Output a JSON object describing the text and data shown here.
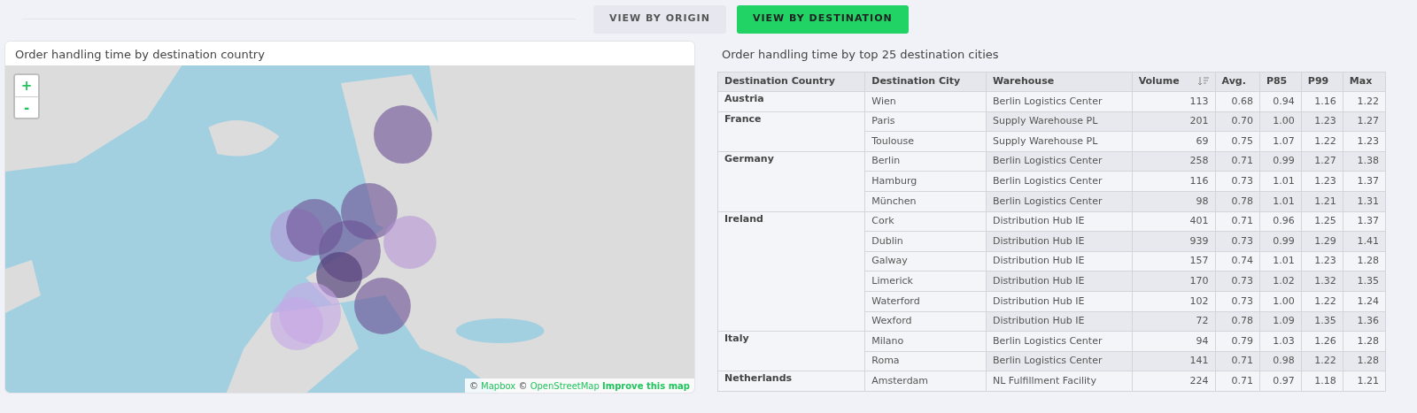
{
  "view_toggle": [
    {
      "label": "VIEW BY ORIGIN",
      "selected": false
    },
    {
      "label": "VIEW BY DESTINATION",
      "selected": true
    }
  ],
  "map_panel": {
    "title": "Order handling time by destination country",
    "zoom_in": "+",
    "zoom_out": "-",
    "attribution": [
      {
        "text": "©",
        "kind": "plain"
      },
      {
        "text": "Mapbox",
        "kind": "link"
      },
      {
        "text": "©",
        "kind": "plain"
      },
      {
        "text": "OpenStreetMap",
        "kind": "link"
      },
      {
        "text": "Improve this map",
        "kind": "strong-link"
      }
    ]
  },
  "table_panel": {
    "title": "Order handling time by top 25 destination cities",
    "columns": [
      {
        "label": "Destination Country",
        "sorted": false
      },
      {
        "label": "Destination City",
        "sorted": false
      },
      {
        "label": "Warehouse",
        "sorted": false
      },
      {
        "label": "Volume",
        "sorted": true
      },
      {
        "label": "Avg.",
        "sorted": false
      },
      {
        "label": "P85",
        "sorted": false
      },
      {
        "label": "P99",
        "sorted": false
      },
      {
        "label": "Max",
        "sorted": false
      }
    ],
    "groups": [
      {
        "country": "Austria",
        "rows": [
          [
            "Wien",
            "Berlin Logistics Center",
            "113",
            "0.68",
            "0.94",
            "1.16",
            "1.22"
          ]
        ]
      },
      {
        "country": "France",
        "rows": [
          [
            "Paris",
            "Supply Warehouse PL",
            "201",
            "0.70",
            "1.00",
            "1.23",
            "1.27"
          ],
          [
            "Toulouse",
            "Supply Warehouse PL",
            "69",
            "0.75",
            "1.07",
            "1.22",
            "1.23"
          ]
        ]
      },
      {
        "country": "Germany",
        "rows": [
          [
            "Berlin",
            "Berlin Logistics Center",
            "258",
            "0.71",
            "0.99",
            "1.27",
            "1.38"
          ],
          [
            "Hamburg",
            "Berlin Logistics Center",
            "116",
            "0.73",
            "1.01",
            "1.23",
            "1.37"
          ],
          [
            "München",
            "Berlin Logistics Center",
            "98",
            "0.78",
            "1.01",
            "1.21",
            "1.31"
          ]
        ]
      },
      {
        "country": "Ireland",
        "rows": [
          [
            "Cork",
            "Distribution Hub IE",
            "401",
            "0.71",
            "0.96",
            "1.25",
            "1.37"
          ],
          [
            "Dublin",
            "Distribution Hub IE",
            "939",
            "0.73",
            "0.99",
            "1.29",
            "1.41"
          ],
          [
            "Galway",
            "Distribution Hub IE",
            "157",
            "0.74",
            "1.01",
            "1.23",
            "1.28"
          ],
          [
            "Limerick",
            "Distribution Hub IE",
            "170",
            "0.73",
            "1.02",
            "1.32",
            "1.35"
          ],
          [
            "Waterford",
            "Distribution Hub IE",
            "102",
            "0.73",
            "1.00",
            "1.22",
            "1.24"
          ],
          [
            "Wexford",
            "Distribution Hub IE",
            "72",
            "0.78",
            "1.09",
            "1.35",
            "1.36"
          ]
        ]
      },
      {
        "country": "Italy",
        "rows": [
          [
            "Milano",
            "Berlin Logistics Center",
            "94",
            "0.79",
            "1.03",
            "1.26",
            "1.28"
          ],
          [
            "Roma",
            "Berlin Logistics Center",
            "141",
            "0.71",
            "0.98",
            "1.22",
            "1.28"
          ]
        ]
      },
      {
        "country": "Netherlands",
        "rows": [
          [
            "Amsterdam",
            "NL Fulfillment Facility",
            "224",
            "0.71",
            "0.97",
            "1.18",
            "1.21"
          ]
        ]
      }
    ]
  }
}
